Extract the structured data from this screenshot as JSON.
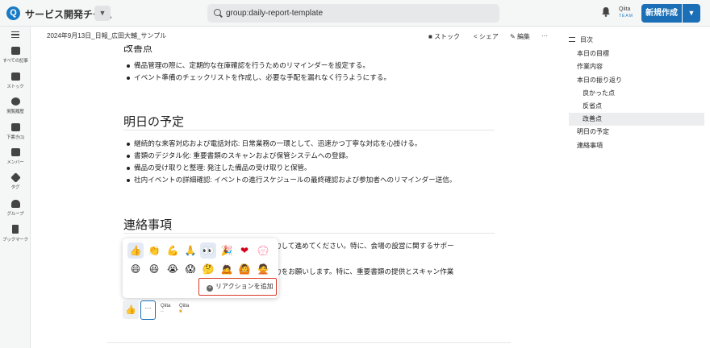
{
  "header": {
    "logo_letter": "Q",
    "team_name": "サービス開発チーム",
    "search_value": "group:daily-report-template",
    "qiita_team_text": "Qiita",
    "qiita_team_sub": "TEAM",
    "new_button": "新規作成",
    "accent": "#1a6fb6"
  },
  "sidebar": {
    "items": [
      {
        "label": "すべての記事",
        "icon": "inbox-icon"
      },
      {
        "label": "ストック",
        "icon": "folder-icon"
      },
      {
        "label": "閲覧履歴",
        "icon": "history-icon"
      },
      {
        "label": "下書き(1)",
        "icon": "draft-icon"
      },
      {
        "label": "メンバー",
        "icon": "member-icon"
      },
      {
        "label": "タグ",
        "icon": "tag-icon"
      },
      {
        "label": "グループ",
        "icon": "group-icon"
      },
      {
        "label": "ブックマーク",
        "icon": "bookmark-icon"
      }
    ]
  },
  "article": {
    "title": "2024年9月13日_日報_広田大輔_サンプル",
    "actions": {
      "stock": "ストック",
      "share": "シェア",
      "edit": "編集",
      "more": "···"
    },
    "partial_heading": "改善点",
    "improve_items": [
      "備品管理の際に、定期的な在庫確認を行うためのリマインダーを設定する。",
      "イベント準備のチェックリストを作成し、必要な手配を漏れなく行うようにする。"
    ],
    "tomorrow_heading": "明日の予定",
    "tomorrow_items": [
      "継続的な来客対応および電話対応: 日常業務の一環として、迅速かつ丁寧な対応を心掛ける。",
      "書類のデジタル化: 重要書類のスキャンおよび保管システムへの登録。",
      "備品の受け取りと整理: 発注した備品の受け取りと保管。",
      "社内イベントの詳細確認: イベントの進行スケジュールの最終確認および参加者へのリマインダー送信。"
    ],
    "contact_heading": "連絡事項",
    "contact_partial_1": "力して進めてください。特に、会場の設営に関するサポー",
    "contact_partial_2": "力をお願いします。特に、重要書類の提供とスキャン作業"
  },
  "picker": {
    "row1": [
      "👍",
      "👏",
      "💪",
      "🙏",
      "👀",
      "🎉",
      "❤",
      "💮"
    ],
    "row2": [
      "😄",
      "😆",
      "😭",
      "😱",
      "🤔",
      "🙇",
      "🙆",
      "🙅"
    ],
    "add_reaction": "リアクションを追加"
  },
  "reactions": {
    "thumbs": "👍",
    "more": "···",
    "qiita1": "Qiita",
    "qiita2": "Qiita"
  },
  "toc": {
    "title": "目次",
    "items": [
      {
        "label": "本日の目標",
        "level": 1
      },
      {
        "label": "作業内容",
        "level": 1
      },
      {
        "label": "本日の振り返り",
        "level": 1
      },
      {
        "label": "良かった点",
        "level": 2
      },
      {
        "label": "反省点",
        "level": 2
      },
      {
        "label": "改善点",
        "level": 2,
        "active": true
      },
      {
        "label": "明日の予定",
        "level": 1
      },
      {
        "label": "連絡事項",
        "level": 1
      }
    ]
  }
}
